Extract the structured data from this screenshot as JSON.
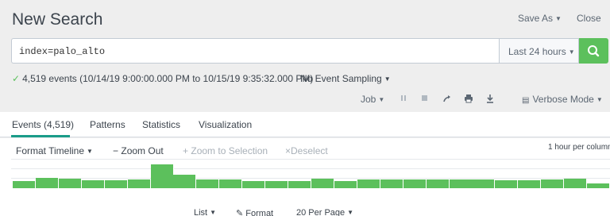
{
  "header": {
    "title": "New Search",
    "save_as": "Save As",
    "close": "Close"
  },
  "search": {
    "query": "index=palo_alto",
    "time_range": "Last 24 hours"
  },
  "status": {
    "text": "4,519 events (10/14/19 9:00:00.000 PM to 10/15/19 9:35:32.000 PM)",
    "sampling": "No Event Sampling"
  },
  "job_toolbar": {
    "job": "Job",
    "mode": "Verbose Mode"
  },
  "tabs": [
    {
      "label": "Events (4,519)",
      "active": true
    },
    {
      "label": "Patterns"
    },
    {
      "label": "Statistics"
    },
    {
      "label": "Visualization"
    }
  ],
  "timeline": {
    "format": "Format Timeline",
    "zoom_out": "Zoom Out",
    "zoom_to_selection": "Zoom to Selection",
    "deselect": "Deselect",
    "per_column": "1 hour per column",
    "bar_color": "#5cc05c",
    "bar_levels": [
      0.28,
      0.42,
      0.36,
      0.3,
      0.32,
      0.34,
      0.95,
      0.52,
      0.34,
      0.34,
      0.28,
      0.28,
      0.28,
      0.38,
      0.28,
      0.34,
      0.34,
      0.34,
      0.34,
      0.34,
      0.34,
      0.3,
      0.32,
      0.34,
      0.38,
      0.18
    ]
  },
  "results_bar": {
    "list": "List",
    "format": "Format",
    "per_page": "20 Per Page"
  },
  "colors": {
    "accent_green": "#5cc05c",
    "tab_underline": "#1a9c89"
  }
}
